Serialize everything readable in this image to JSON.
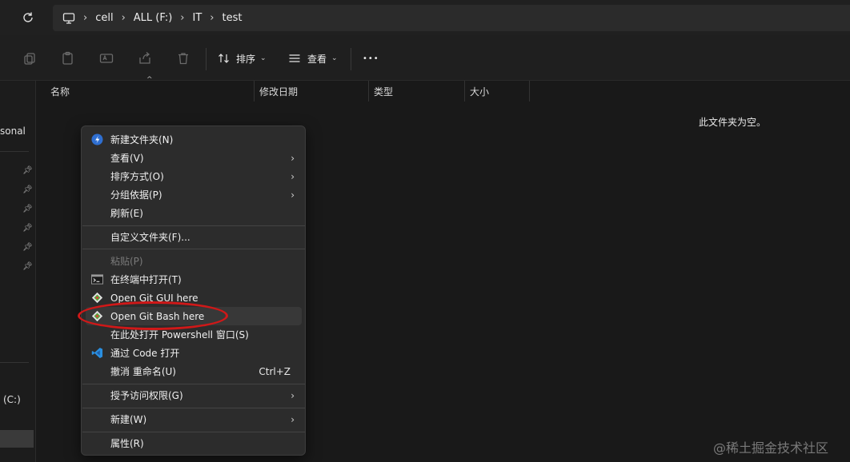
{
  "address": {
    "crumbs": [
      "cell",
      "ALL (F:)",
      "IT",
      "test"
    ]
  },
  "toolbar": {
    "sort_label": "排序",
    "view_label": "查看",
    "more_label": "•••"
  },
  "sidebar": {
    "partial_top": "sonal",
    "partial_drive": "(C:)"
  },
  "columns": [
    "名称",
    "修改日期",
    "类型",
    "大小"
  ],
  "empty_message": "此文件夹为空。",
  "context_menu": {
    "items": [
      {
        "label": "新建文件夹(N)",
        "icon": "new-folder-icon"
      },
      {
        "label": "查看(V)",
        "submenu": true
      },
      {
        "label": "排序方式(O)",
        "submenu": true
      },
      {
        "label": "分组依据(P)",
        "submenu": true
      },
      {
        "label": "刷新(E)"
      },
      {
        "label": "自定义文件夹(F)..."
      },
      {
        "label": "粘贴(P)",
        "disabled": true
      },
      {
        "label": "在终端中打开(T)",
        "icon": "terminal-icon"
      },
      {
        "label": "Open Git GUI here",
        "icon": "git-icon"
      },
      {
        "label": "Open Git Bash here",
        "icon": "git-icon"
      },
      {
        "label": "在此处打开 Powershell 窗口(S)"
      },
      {
        "label": "通过 Code 打开",
        "icon": "vscode-icon"
      },
      {
        "label": "撤消 重命名(U)",
        "shortcut": "Ctrl+Z"
      },
      {
        "label": "授予访问权限(G)",
        "submenu": true
      },
      {
        "label": "新建(W)",
        "submenu": true
      },
      {
        "label": "属性(R)"
      }
    ]
  },
  "watermark": "@稀土掘金技术社区",
  "colors": {
    "background": "#191919",
    "menu_bg": "#2c2c2c",
    "highlight_ring": "#d01818"
  }
}
